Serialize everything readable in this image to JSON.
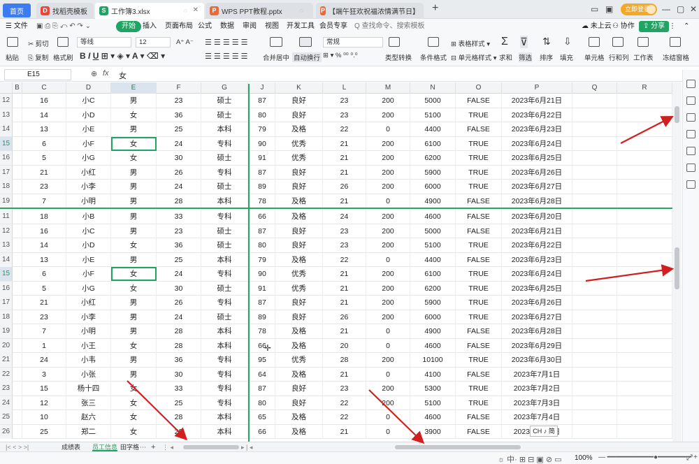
{
  "tabs": [
    {
      "label": "首页"
    },
    {
      "label": "找稻壳模板",
      "icon": "D",
      "color": "#e8483b"
    },
    {
      "label": "工作簿3.xlsx",
      "icon": "S",
      "color": "#1fa463"
    },
    {
      "label": "WPS PPT教程.pptx",
      "icon": "P",
      "color": "#e8693b"
    },
    {
      "label": "【端午狂欢祝福浓情满节日】",
      "icon": "P",
      "color": "#e8693b"
    }
  ],
  "title_actions": {
    "new_tab": "+",
    "login": "立即登录"
  },
  "menu": {
    "file": "文件",
    "start": "开始",
    "insert": "插入",
    "layout": "页面布局",
    "formula": "公式",
    "data": "数据",
    "review": "审阅",
    "view": "视图",
    "dev": "开发工具",
    "member": "会员专享",
    "search": "Q 查找命令、搜索模板",
    "cloud": "未上云",
    "collab": "协作",
    "share": "分享"
  },
  "ribbon": {
    "cut": "剪切",
    "paste": "粘贴",
    "copy": "复制",
    "format_painter": "格式刷",
    "font_name": "等线",
    "font_size": "12",
    "merge": "合并居中",
    "wrap": "自动换行",
    "num_format": "常规",
    "type_convert": "类型转换",
    "cond_format": "条件格式",
    "table_style": "表格样式",
    "cell_style": "单元格样式",
    "sum": "求和",
    "filter": "筛选",
    "sort": "排序",
    "fill": "填充",
    "cell": "单元格",
    "rowcol": "行和列",
    "sheet": "工作表",
    "freeze": "冻结窗格"
  },
  "formula_bar": {
    "cell_ref": "E15",
    "fx": "fx",
    "content": "女"
  },
  "columns": [
    "B",
    "C",
    "D",
    "E",
    "F",
    "G",
    "J",
    "K",
    "L",
    "M",
    "N",
    "O",
    "P",
    "Q",
    "R"
  ],
  "top_rows": [
    {
      "n": "12",
      "c": "16",
      "d": "小C",
      "e": "男",
      "f": "23",
      "g": "硕士",
      "j": "87",
      "k": "良好",
      "l": "23",
      "m": "200",
      "nn": "5000",
      "o": "FALSE",
      "p": "2023年6月21日"
    },
    {
      "n": "13",
      "c": "14",
      "d": "小D",
      "e": "女",
      "f": "36",
      "g": "硕士",
      "j": "80",
      "k": "良好",
      "l": "23",
      "m": "200",
      "nn": "5100",
      "o": "TRUE",
      "p": "2023年6月22日"
    },
    {
      "n": "14",
      "c": "13",
      "d": "小E",
      "e": "男",
      "f": "25",
      "g": "本科",
      "j": "79",
      "k": "及格",
      "l": "22",
      "m": "0",
      "nn": "4400",
      "o": "FALSE",
      "p": "2023年6月23日"
    },
    {
      "n": "15",
      "c": "6",
      "d": "小F",
      "e": "女",
      "f": "24",
      "g": "专科",
      "j": "90",
      "k": "优秀",
      "l": "21",
      "m": "200",
      "nn": "6100",
      "o": "TRUE",
      "p": "2023年6月24日",
      "sel": true
    },
    {
      "n": "16",
      "c": "5",
      "d": "小G",
      "e": "女",
      "f": "30",
      "g": "硕士",
      "j": "91",
      "k": "优秀",
      "l": "21",
      "m": "200",
      "nn": "6200",
      "o": "TRUE",
      "p": "2023年6月25日"
    },
    {
      "n": "17",
      "c": "21",
      "d": "小红",
      "e": "男",
      "f": "26",
      "g": "专科",
      "j": "87",
      "k": "良好",
      "l": "21",
      "m": "200",
      "nn": "5900",
      "o": "TRUE",
      "p": "2023年6月26日"
    },
    {
      "n": "18",
      "c": "23",
      "d": "小李",
      "e": "男",
      "f": "24",
      "g": "硕士",
      "j": "89",
      "k": "良好",
      "l": "26",
      "m": "200",
      "nn": "6000",
      "o": "TRUE",
      "p": "2023年6月27日"
    },
    {
      "n": "19",
      "c": "7",
      "d": "小明",
      "e": "男",
      "f": "28",
      "g": "本科",
      "j": "78",
      "k": "及格",
      "l": "21",
      "m": "0",
      "nn": "4900",
      "o": "FALSE",
      "p": "2023年6月28日"
    }
  ],
  "bottom_rows": [
    {
      "n": "11",
      "c": "18",
      "d": "小B",
      "e": "男",
      "f": "33",
      "g": "专科",
      "j": "66",
      "k": "及格",
      "l": "24",
      "m": "200",
      "nn": "4600",
      "o": "FALSE",
      "p": "2023年6月20日"
    },
    {
      "n": "12",
      "c": "16",
      "d": "小C",
      "e": "男",
      "f": "23",
      "g": "硕士",
      "j": "87",
      "k": "良好",
      "l": "23",
      "m": "200",
      "nn": "5000",
      "o": "FALSE",
      "p": "2023年6月21日"
    },
    {
      "n": "13",
      "c": "14",
      "d": "小D",
      "e": "女",
      "f": "36",
      "g": "硕士",
      "j": "80",
      "k": "良好",
      "l": "23",
      "m": "200",
      "nn": "5100",
      "o": "TRUE",
      "p": "2023年6月22日"
    },
    {
      "n": "14",
      "c": "13",
      "d": "小E",
      "e": "男",
      "f": "25",
      "g": "本科",
      "j": "79",
      "k": "及格",
      "l": "22",
      "m": "0",
      "nn": "4400",
      "o": "FALSE",
      "p": "2023年6月23日"
    },
    {
      "n": "15",
      "c": "6",
      "d": "小F",
      "e": "女",
      "f": "24",
      "g": "专科",
      "j": "90",
      "k": "优秀",
      "l": "21",
      "m": "200",
      "nn": "6100",
      "o": "TRUE",
      "p": "2023年6月24日",
      "sel": true
    },
    {
      "n": "16",
      "c": "5",
      "d": "小G",
      "e": "女",
      "f": "30",
      "g": "硕士",
      "j": "91",
      "k": "优秀",
      "l": "21",
      "m": "200",
      "nn": "6200",
      "o": "TRUE",
      "p": "2023年6月25日"
    },
    {
      "n": "17",
      "c": "21",
      "d": "小红",
      "e": "男",
      "f": "26",
      "g": "专科",
      "j": "87",
      "k": "良好",
      "l": "21",
      "m": "200",
      "nn": "5900",
      "o": "TRUE",
      "p": "2023年6月26日"
    },
    {
      "n": "18",
      "c": "23",
      "d": "小李",
      "e": "男",
      "f": "24",
      "g": "硕士",
      "j": "89",
      "k": "良好",
      "l": "26",
      "m": "200",
      "nn": "6000",
      "o": "TRUE",
      "p": "2023年6月27日"
    },
    {
      "n": "19",
      "c": "7",
      "d": "小明",
      "e": "男",
      "f": "28",
      "g": "本科",
      "j": "78",
      "k": "及格",
      "l": "21",
      "m": "0",
      "nn": "4900",
      "o": "FALSE",
      "p": "2023年6月28日"
    },
    {
      "n": "20",
      "c": "1",
      "d": "小王",
      "e": "女",
      "f": "28",
      "g": "本科",
      "j": "66",
      "k": "及格",
      "l": "20",
      "m": "0",
      "nn": "4600",
      "o": "FALSE",
      "p": "2023年6月29日"
    },
    {
      "n": "21",
      "c": "24",
      "d": "小韦",
      "e": "男",
      "f": "36",
      "g": "专科",
      "j": "95",
      "k": "优秀",
      "l": "28",
      "m": "200",
      "nn": "10100",
      "o": "TRUE",
      "p": "2023年6月30日"
    },
    {
      "n": "22",
      "c": "3",
      "d": "小张",
      "e": "男",
      "f": "30",
      "g": "专科",
      "j": "64",
      "k": "及格",
      "l": "21",
      "m": "0",
      "nn": "4100",
      "o": "FALSE",
      "p": "2023年7月1日"
    },
    {
      "n": "23",
      "c": "15",
      "d": "杨十四",
      "e": "女",
      "f": "33",
      "g": "专科",
      "j": "87",
      "k": "良好",
      "l": "23",
      "m": "200",
      "nn": "5300",
      "o": "TRUE",
      "p": "2023年7月2日"
    },
    {
      "n": "24",
      "c": "12",
      "d": "张三",
      "e": "女",
      "f": "25",
      "g": "专科",
      "j": "80",
      "k": "良好",
      "l": "22",
      "m": "200",
      "nn": "5100",
      "o": "TRUE",
      "p": "2023年7月3日"
    },
    {
      "n": "25",
      "c": "10",
      "d": "赵六",
      "e": "女",
      "f": "28",
      "g": "本科",
      "j": "65",
      "k": "及格",
      "l": "22",
      "m": "0",
      "nn": "4600",
      "o": "FALSE",
      "p": "2023年7月4日"
    },
    {
      "n": "26",
      "c": "25",
      "d": "郑二",
      "e": "女",
      "f": "28",
      "g": "本科",
      "j": "66",
      "k": "及格",
      "l": "21",
      "m": "0",
      "nn": "3900",
      "o": "FALSE",
      "p": "2023年7月5日"
    }
  ],
  "sheets": [
    "成绩表",
    "员工信息",
    "田字格"
  ],
  "active_sheet": "员工信息",
  "status": {
    "zoom": "100%",
    "ime": "CH ♪ 简"
  },
  "accent": "#1fa463",
  "arrow_color": "#d11f1f"
}
